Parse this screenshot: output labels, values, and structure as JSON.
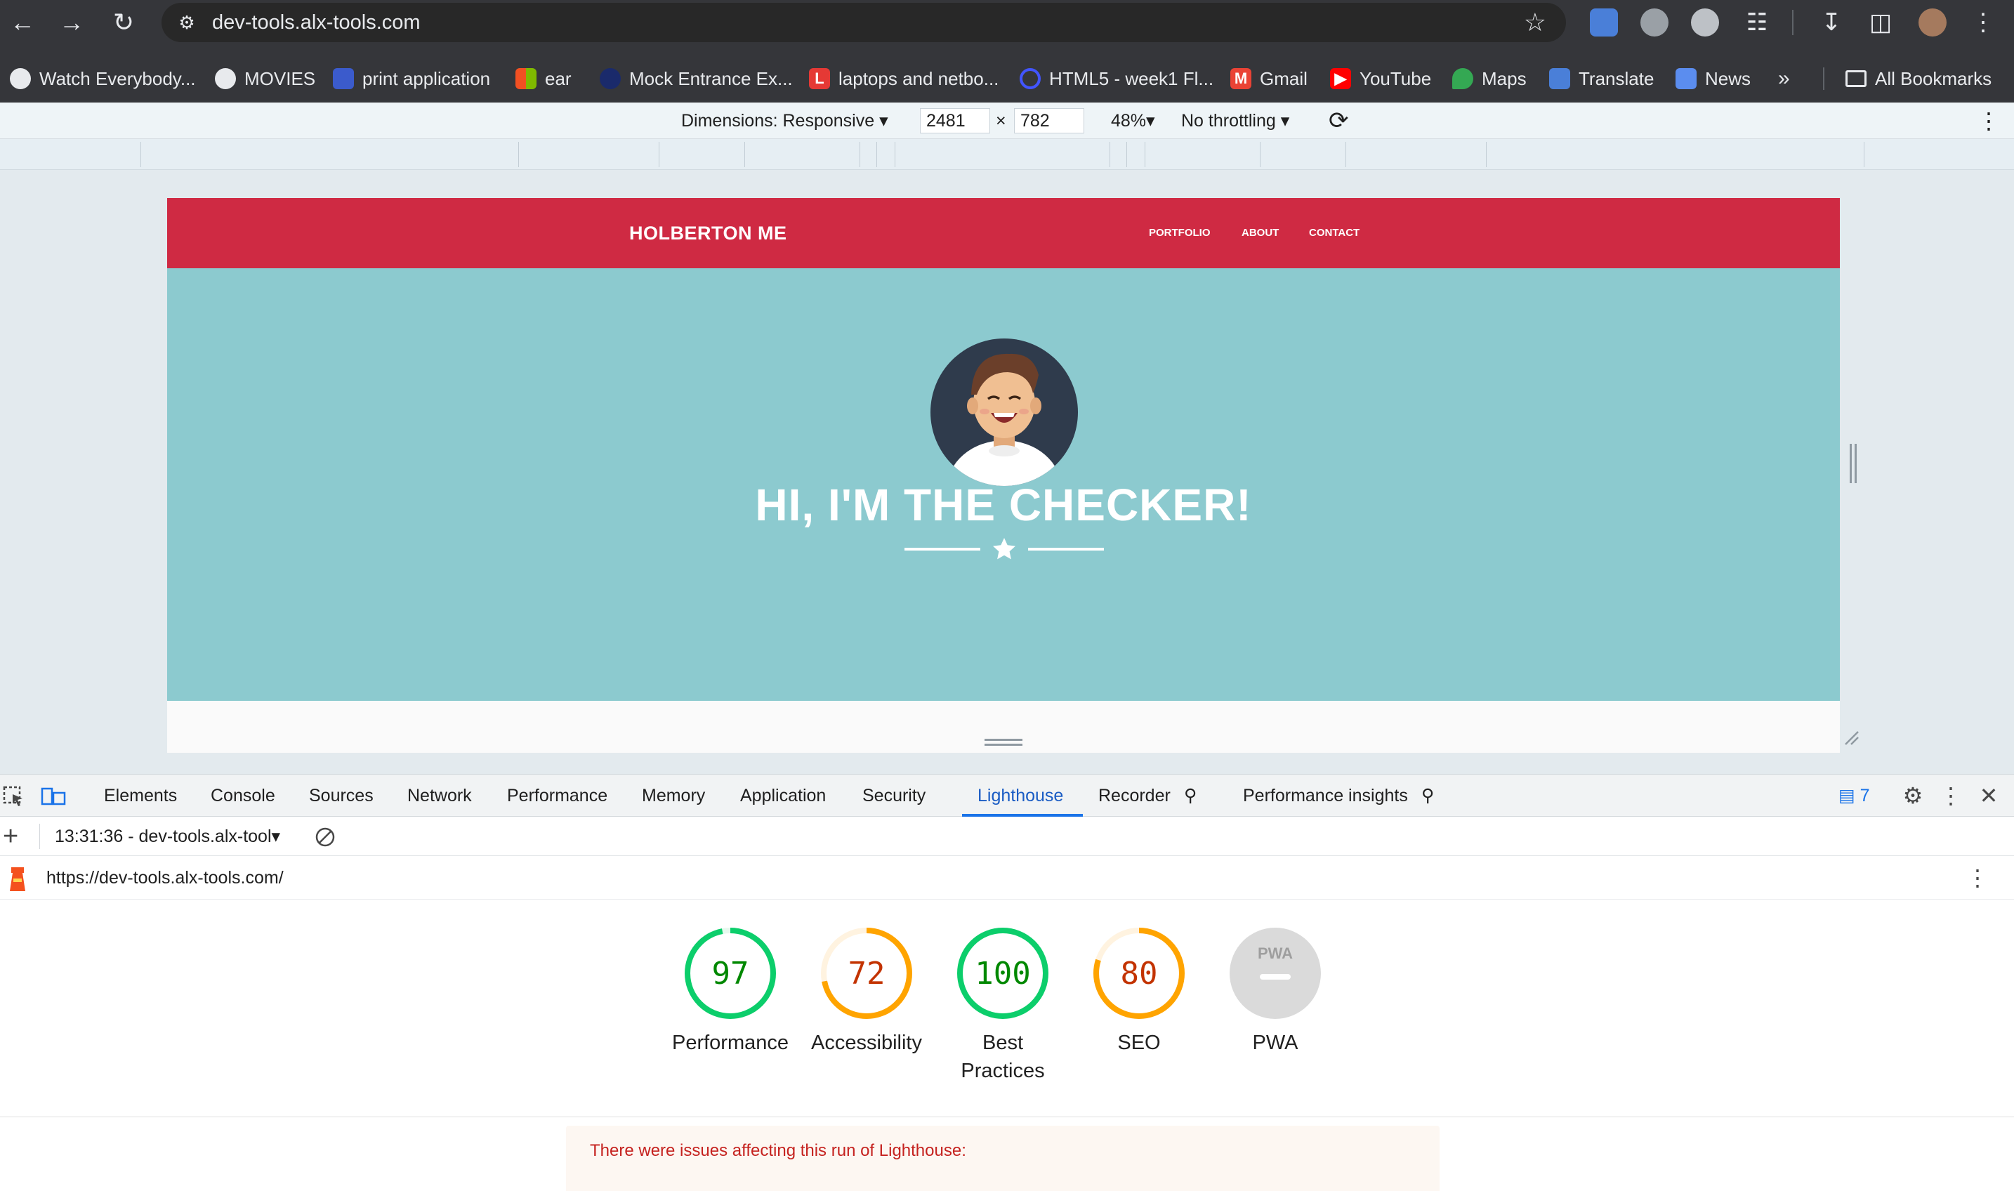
{
  "browser": {
    "url": "dev-tools.alx-tools.com",
    "bookmarks": [
      {
        "label": "Watch Everybody...",
        "icon": "globe-icon"
      },
      {
        "label": "MOVIES",
        "icon": "globe-icon"
      },
      {
        "label": "print application",
        "icon": "print-app-icon"
      },
      {
        "label": "ear",
        "icon": "microsoft-icon"
      },
      {
        "label": "Mock Entrance Ex...",
        "icon": "school-icon"
      },
      {
        "label": "laptops and netbo...",
        "icon": "letter-l-icon"
      },
      {
        "label": "HTML5 - week1 Fl...",
        "icon": "quizlet-icon"
      },
      {
        "label": "Gmail",
        "icon": "gmail-icon"
      },
      {
        "label": "YouTube",
        "icon": "youtube-icon"
      },
      {
        "label": "Maps",
        "icon": "maps-icon"
      },
      {
        "label": "Translate",
        "icon": "translate-icon"
      },
      {
        "label": "News",
        "icon": "news-icon"
      }
    ],
    "all_bookmarks": "All Bookmarks"
  },
  "device_toolbar": {
    "dimensions": "Dimensions: Responsive",
    "width": "2481",
    "times": "×",
    "height": "782",
    "zoom": "48%",
    "throttling": "No throttling"
  },
  "site": {
    "logo": "HOLBERTON ME",
    "nav": [
      "PORTFOLIO",
      "ABOUT",
      "CONTACT"
    ],
    "hero_title": "HI, I'M THE CHECKER!",
    "colors": {
      "header": "#cf2a43",
      "hero": "#8ccacf"
    }
  },
  "devtools": {
    "tabs": [
      "Elements",
      "Console",
      "Sources",
      "Network",
      "Performance",
      "Memory",
      "Application",
      "Security",
      "Lighthouse",
      "Recorder",
      "Performance insights"
    ],
    "active_tab": "Lighthouse",
    "issues_count": "7",
    "report_selector": "13:31:36 - dev-tools.alx-tool",
    "report_url": "https://dev-tools.alx-tools.com/"
  },
  "lighthouse": {
    "scores": [
      {
        "label": "Performance",
        "score": "97",
        "value": 97,
        "color": "#0cce6b",
        "text_color": "#008800"
      },
      {
        "label": "Accessibility",
        "score": "72",
        "value": 72,
        "color": "#ffa400",
        "text_color": "#c33300"
      },
      {
        "label": "Best Practices",
        "label_line1": "Best",
        "label_line2": "Practices",
        "score": "100",
        "value": 100,
        "color": "#0cce6b",
        "text_color": "#008800"
      },
      {
        "label": "SEO",
        "score": "80",
        "value": 80,
        "color": "#ffa400",
        "text_color": "#c33300"
      },
      {
        "label": "PWA",
        "score": "",
        "value": 0,
        "color": "#dadada",
        "text_color": "#9e9e9e"
      }
    ],
    "pwa_badge": "PWA",
    "warning": "There were issues affecting this run of Lighthouse:"
  }
}
